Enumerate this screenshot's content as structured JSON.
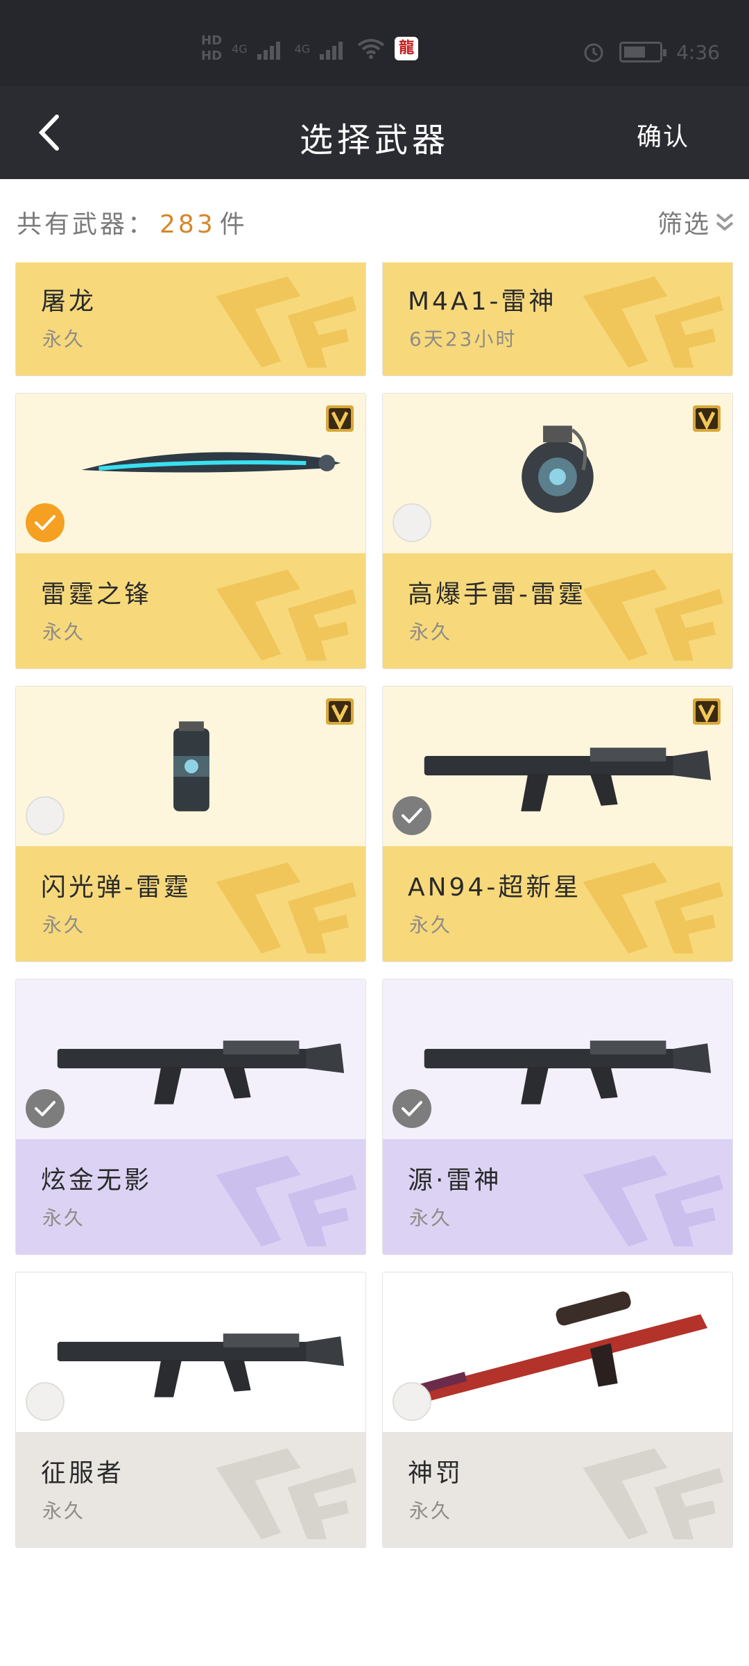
{
  "status_bar": {
    "hd_top": "HD",
    "hd_bottom": "HD",
    "net_1": "4G",
    "net_2": "4G",
    "app_badge": "龍",
    "time": "4:36",
    "icons": [
      "signal-icon",
      "wifi-icon",
      "alarm-icon",
      "battery-icon"
    ]
  },
  "nav": {
    "title": "选择武器",
    "confirm_label": "确认",
    "back_icon": "chevron-left-icon"
  },
  "summary": {
    "count_prefix": "共有武器：",
    "count_value": "283",
    "count_suffix": "件",
    "filter_label": "筛选",
    "filter_icon": "double-chevron-down-icon"
  },
  "colors": {
    "gold_top": "#fdf6dc",
    "gold_bottom": "#f7d97c",
    "purple_top": "#f3f0fb",
    "purple_bottom": "#dcd3f4",
    "white_bottom": "#e9e6e2",
    "selected_check": "#f5a021",
    "count_accent": "#d4872a"
  },
  "weapons": [
    {
      "name": "屠龙",
      "duration": "永久",
      "rarity": "gold",
      "badge": false,
      "check": "unchecked",
      "icon": "blade-weapon-icon"
    },
    {
      "name": "M4A1-雷神",
      "duration": "6天23小时",
      "rarity": "gold",
      "badge": false,
      "check": "unchecked",
      "icon": "rifle-icon"
    },
    {
      "name": "雷霆之锋",
      "duration": "永久",
      "rarity": "gold",
      "badge": true,
      "check": "orange",
      "icon": "blade-weapon-icon"
    },
    {
      "name": "高爆手雷-雷霆",
      "duration": "永久",
      "rarity": "gold",
      "badge": true,
      "check": "unchecked",
      "icon": "grenade-icon"
    },
    {
      "name": "闪光弹-雷霆",
      "duration": "永久",
      "rarity": "gold",
      "badge": true,
      "check": "unchecked",
      "icon": "flashbang-icon"
    },
    {
      "name": "AN94-超新星",
      "duration": "永久",
      "rarity": "gold",
      "badge": true,
      "check": "grey",
      "icon": "rifle-icon"
    },
    {
      "name": "炫金无影",
      "duration": "永久",
      "rarity": "purple",
      "badge": false,
      "check": "grey",
      "icon": "rifle-icon"
    },
    {
      "name": "源·雷神",
      "duration": "永久",
      "rarity": "purple",
      "badge": false,
      "check": "grey",
      "icon": "rifle-icon"
    },
    {
      "name": "征服者",
      "duration": "永久",
      "rarity": "white",
      "badge": false,
      "check": "unchecked",
      "icon": "rifle-icon"
    },
    {
      "name": "神罚",
      "duration": "永久",
      "rarity": "white",
      "badge": false,
      "check": "unchecked",
      "icon": "sniper-rifle-icon"
    }
  ]
}
